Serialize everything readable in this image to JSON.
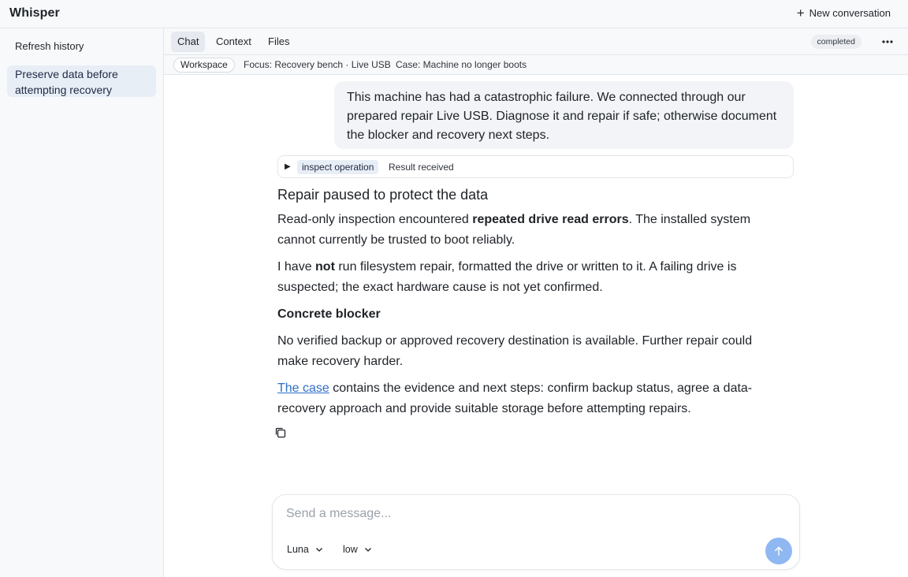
{
  "app": {
    "title": "Whisper",
    "new_conversation_label": "New conversation"
  },
  "sidebar": {
    "refresh_label": "Refresh history",
    "items": [
      {
        "label": "Preserve data before attempting recovery",
        "active": true
      }
    ]
  },
  "header": {
    "tabs": [
      {
        "label": "Chat",
        "active": true
      },
      {
        "label": "Context"
      },
      {
        "label": "Files"
      }
    ],
    "status": "completed"
  },
  "context_bar": {
    "workspace_label": "Workspace",
    "focus": "Focus: Recovery bench · Live USB",
    "case": "Case: Machine no longer boots"
  },
  "messages": {
    "user": "This machine has had a catastrophic failure. We connected through our prepared repair Live USB. Diagnose it and repair if safe; otherwise document the blocker and recovery next steps.",
    "tool": {
      "operation": "inspect operation",
      "result": "Result received"
    },
    "answer": {
      "heading": "Repair paused to protect the data",
      "p1_pre": "Read-only inspection encountered ",
      "p1_bold": "repeated drive read errors",
      "p1_post": ". The installed system cannot currently be trusted to boot reliably.",
      "p2_pre": "I have ",
      "p2_bold": "not",
      "p2_post": " run filesystem repair, formatted the drive or written to it. A failing drive is suspected; the exact hardware cause is not yet confirmed.",
      "blocker_heading": "Concrete blocker",
      "p3": "No verified backup or approved recovery destination is available. Further repair could make recovery harder.",
      "p4_link": "The case",
      "p4_post": " contains the evidence and next steps: confirm backup status, agree a data-recovery approach and provide suitable storage before attempting repairs."
    }
  },
  "composer": {
    "placeholder": "Send a message...",
    "model": "Luna",
    "effort": "low"
  },
  "colors": {
    "accent": "#2f6fc9",
    "send_button": "#8fb7f2",
    "active_item": "#e8eef6"
  }
}
